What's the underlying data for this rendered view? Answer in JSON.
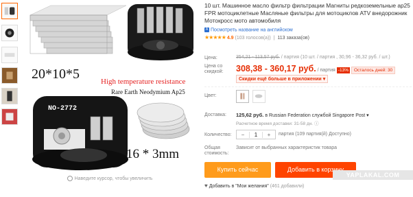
{
  "product": {
    "title": "10 шт. Машинное масло фильтр фильтрации Магниты редкоземельные ap25 FPR мотоциклетные Масляные фильтры для мотоциклов ATV внедорожник Мотокросс мото автомобиля",
    "translated_link": "Посмотреть название на английском",
    "rating_score": "4.9",
    "rating_votes": "(103 голосов(а))",
    "orders": "113 заказа(ов)",
    "stars": "★★★★★"
  },
  "image_text": {
    "size_large": "20*10*5",
    "size_round": "16 * 3mm",
    "badge_line1": "High temperature resistance",
    "badge_line2": "Rare Earth Neodymium Ap25",
    "filter_label": "NO-2772",
    "zoom_hint": "Наведите курсор, чтобы увеличить"
  },
  "price": {
    "old_label": "Цена:",
    "old_value": "354,21 - 113,57 руб.",
    "old_unit": "/ партия (10 шт. / партия , 30,96 - 36,32 руб. / шт.)",
    "new_label_1": "Цена со",
    "new_label_2": "скидкой:",
    "new_value": "308,38 - 360,17 руб.",
    "new_unit": "/ партия",
    "discount": "-13%",
    "timer": "Осталось дней: 30",
    "app_deal": "Скидки ещё больше в приложении",
    "app_deal_arrow": "▾"
  },
  "color": {
    "label": "Цвет:"
  },
  "shipping": {
    "label": "Доставка:",
    "price": "125,62 руб.",
    "to": "в Russian Federation службой Singapore Post",
    "arrow": "▾",
    "time": "Расчетное время доставки: 31-58 дн.",
    "info_icon": "ⓘ"
  },
  "quantity": {
    "label": "Количество:",
    "minus": "−",
    "value": "1",
    "plus": "+",
    "available": "партия (109 партия(й) Доступно)"
  },
  "total": {
    "label_1": "Общая",
    "label_2": "стоимость:",
    "value": "Зависит от выбранных характеристик товара"
  },
  "actions": {
    "buy_now": "Купить сейчас",
    "add_to_cart": "Добавить в корзину",
    "wishlist": "Добавить в \"Мои желания\"",
    "wishlist_count": "(461 добавили)",
    "heart": "♥"
  },
  "watermark": "YAPLAKAL.COM",
  "icons": {
    "translate": "translate-icon",
    "magnifier": "magnifier-icon",
    "heart": "heart-icon",
    "info": "info-icon"
  },
  "colors": {
    "accent_price": "#e62e04",
    "buy_button": "#ff9b1b",
    "cart_button": "#ff4400",
    "stars": "#ff9900"
  }
}
